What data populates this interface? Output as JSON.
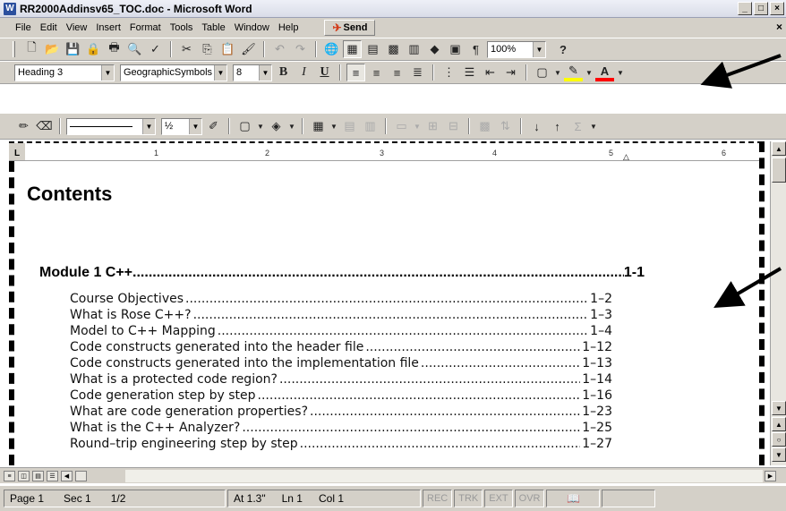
{
  "window": {
    "title": "RR2000Addinsv65_TOC.doc - Microsoft Word",
    "app_icon": "W",
    "minimize": "_",
    "maximize": "□",
    "close": "×"
  },
  "menu": {
    "items": [
      "File",
      "Edit",
      "View",
      "Insert",
      "Format",
      "Tools",
      "Table",
      "Window",
      "Help"
    ],
    "send_label": "Send",
    "doc_close": "×"
  },
  "standard_toolbar": {
    "zoom": "100%",
    "pilcrow": "¶",
    "help": "?"
  },
  "format_toolbar": {
    "style": "Heading 3",
    "font": "GeographicSymbols",
    "size": "8",
    "bold": "B",
    "italic": "I",
    "underline": "U"
  },
  "drawing_toolbar": {
    "line_weight": "½",
    "sigma": "Σ"
  },
  "ruler": {
    "corner": "L",
    "numbers": [
      "1",
      "2",
      "3",
      "4",
      "5",
      "6"
    ]
  },
  "document": {
    "title": "Contents",
    "main_entry": {
      "text": "Module 1 C++",
      "page": "1-1"
    },
    "entries": [
      {
        "text": "Course Objectives",
        "page": "1–2"
      },
      {
        "text": "What is Rose C++?",
        "page": "1–3"
      },
      {
        "text": "Model to C++ Mapping",
        "page": "1–4"
      },
      {
        "text": "Code constructs generated into the header file",
        "page": "1–12"
      },
      {
        "text": "Code constructs generated into the implementation file",
        "page": "1–13"
      },
      {
        "text": "What is a protected code region?",
        "page": "1–14"
      },
      {
        "text": "Code generation step by step",
        "page": "1–16"
      },
      {
        "text": "What are code generation properties?",
        "page": "1–23"
      },
      {
        "text": "What is the C++ Analyzer?",
        "page": "1–25"
      },
      {
        "text": "Round–trip engineering step by step",
        "page": "1–27"
      }
    ]
  },
  "status": {
    "page": "Page 1",
    "sec": "Sec 1",
    "pages": "1/2",
    "at": "At 1.3\"",
    "ln": "Ln 1",
    "col": "Col 1",
    "rec": "REC",
    "trk": "TRK",
    "ext": "EXT",
    "ovr": "OVR"
  },
  "colors": {
    "chrome": "#d4d0c8",
    "highlighter": "#ffff00",
    "font_color": "#ff0000",
    "send_icon": "#d23b1a"
  }
}
